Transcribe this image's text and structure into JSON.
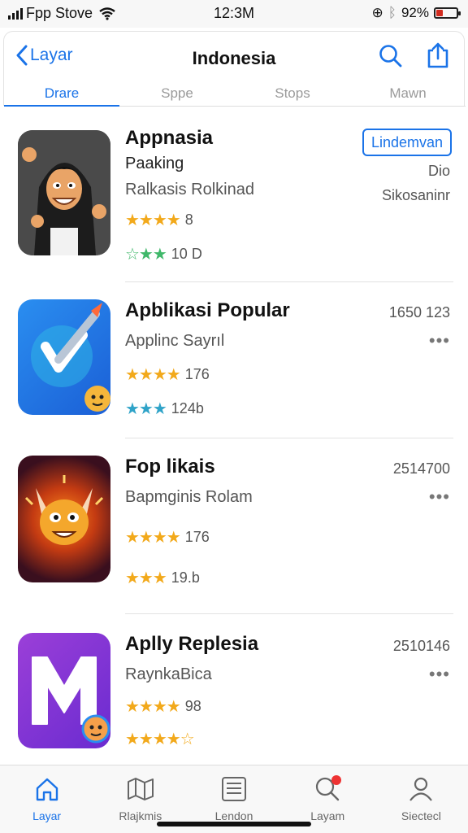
{
  "status_bar": {
    "carrier": "Fpp Stove",
    "time": "12:3M",
    "battery": "92%"
  },
  "header": {
    "back_label": "Layar",
    "title": "Indonesia",
    "segments": [
      "Drare",
      "Sppe",
      "Stops",
      "Mawn"
    ],
    "active_segment": 0
  },
  "apps": [
    {
      "name": "Appnasia",
      "subtitle": "Paaking",
      "developer": "Ralkasis Rolkinad",
      "rating_stars": "★★★★",
      "rating_count": "8",
      "secondary_stars": "☆★★",
      "secondary_count": "10 D",
      "button_label": "Lindemvan",
      "meta_top": "Dio",
      "meta_bottom": "Sikosaninr"
    },
    {
      "name": "Apblikasi Popular",
      "subtitle": "Applinc Sayrıl",
      "rating_stars": "★★★★",
      "rating_count": "176",
      "secondary_stars": "★★★",
      "secondary_count": "124b",
      "meta_top": "1650 123",
      "more": "•••"
    },
    {
      "name": "Fop likais",
      "subtitle": "Bapmginis Rolam",
      "rating_stars": "★★★★",
      "rating_count": "176",
      "secondary_stars": "★★★",
      "secondary_count": "19.b",
      "meta_top": "2514700",
      "more": "•••"
    },
    {
      "name": "Aplly Replesia",
      "subtitle": "RaynkaBica",
      "rating_stars": "★★★★",
      "rating_count": "98",
      "secondary_stars": "★★★★☆",
      "meta_top": "2510146",
      "more": "•••"
    }
  ],
  "tabs": [
    {
      "label": "Layar",
      "icon": "home-icon"
    },
    {
      "label": "Rlajkmis",
      "icon": "map-icon"
    },
    {
      "label": "Lendon",
      "icon": "list-icon"
    },
    {
      "label": "Layam",
      "icon": "search-icon"
    },
    {
      "label": "Siectecl",
      "icon": "person-icon"
    }
  ],
  "colors": {
    "accent": "#1a73e8",
    "star": "#f2a91b",
    "badge": "#e33333"
  }
}
